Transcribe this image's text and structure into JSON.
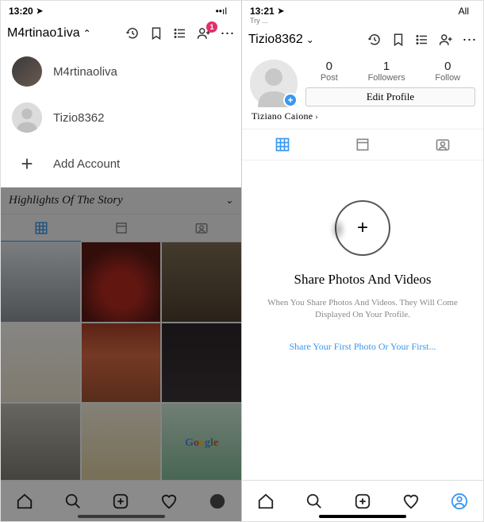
{
  "left": {
    "status": {
      "time": "13:20",
      "loc_glyph": "➤",
      "signal": "••ıl",
      "wifi": "wifi",
      "battery": "batt"
    },
    "header": {
      "username": "M4rtinao1iva",
      "chevron": "⌃",
      "notif_count": "1"
    },
    "accounts": [
      {
        "name": "M4rtinaoliva",
        "has_photo": true
      },
      {
        "name": "Tizio8362",
        "has_photo": false
      }
    ],
    "add_account_label": "Add Account",
    "highlights_label": "Highlights Of The Story",
    "google_label": "Google"
  },
  "right": {
    "status": {
      "time": "13:21",
      "loc_glyph": "➤",
      "carrier": "All",
      "wifi": "wifi",
      "battery": "batt"
    },
    "truncated_above": "Try ...",
    "header": {
      "username": "Tizio8362",
      "chevron": "⌄"
    },
    "stats": {
      "posts_n": "0",
      "posts_l": "Post",
      "followers_n": "1",
      "followers_l": "Followers",
      "follow_n": "0",
      "follow_l": "Follow"
    },
    "edit_profile_label": "Edit Profile",
    "display_name": "Tiziano Caione",
    "empty": {
      "title": "Share Photos And Videos",
      "subtitle": "When You Share Photos And Videos. They Will Come Displayed On Your Profile.",
      "link": "Share Your First Photo Or Your First..."
    }
  }
}
